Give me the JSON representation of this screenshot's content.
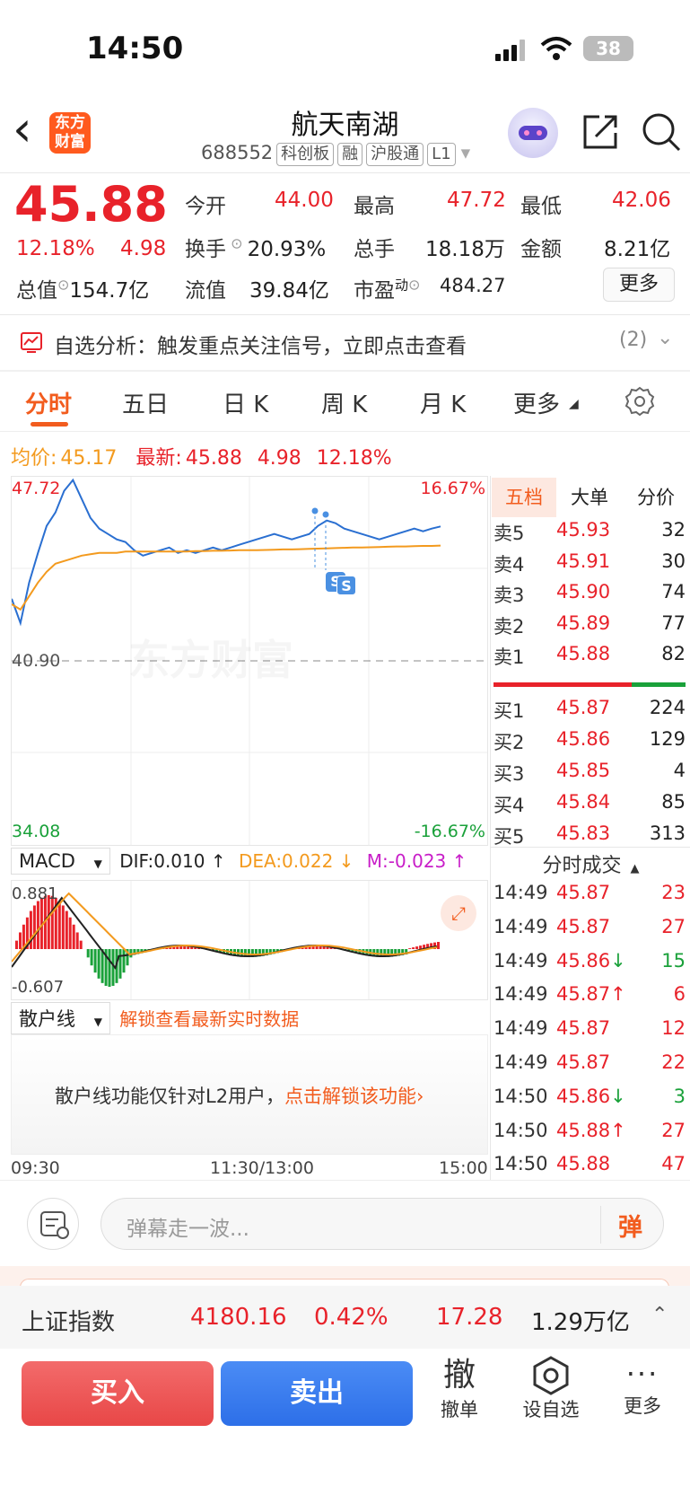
{
  "status": {
    "time": "14:50",
    "battery": "38"
  },
  "nav": {
    "back": "‹",
    "logo_line1": "东方",
    "logo_line2": "财富",
    "title": "航天南湖",
    "code": "688552",
    "tags": [
      "科创板",
      "融",
      "沪股通",
      "L1"
    ]
  },
  "quote": {
    "price": "45.88",
    "pct": "12.18%",
    "chg": "4.98",
    "open_label": "今开",
    "open": "44.00",
    "high_label": "最高",
    "high": "47.72",
    "low_label": "最低",
    "low": "42.06",
    "turnover_label": "换手",
    "turnover": "20.93%",
    "volume_label": "总手",
    "volume": "18.18万",
    "amount_label": "金额",
    "amount": "8.21亿",
    "mcap_label": "总值",
    "mcap": "154.7亿",
    "float_label": "流值",
    "float": "39.84亿",
    "pe_label": "市盈",
    "pe_sup": "动",
    "pe": "484.27",
    "more": "更多"
  },
  "alert": {
    "text": "自选分析：触发重点关注信号，立即点击查看",
    "count": "(2)"
  },
  "tabs": [
    "分时",
    "五日",
    "日 K",
    "周 K",
    "月 K",
    "更多"
  ],
  "chart_info": {
    "avg_label": "均价:",
    "avg": "45.17",
    "latest_label": "最新:",
    "latest": "45.88",
    "chg": "4.98",
    "pct": "12.18%"
  },
  "chart_data": {
    "type": "line",
    "title": "",
    "ylim": [
      34.08,
      47.72
    ],
    "y_top": "47.72",
    "y_mid": "40.90",
    "y_bottom": "34.08",
    "pct_top": "16.67%",
    "pct_bottom": "-16.67%",
    "x_labels": [
      "09:30",
      "11:30/13:00",
      "15:00"
    ],
    "watermark": "东方财富",
    "series": [
      {
        "name": "最新",
        "color": "#2a6fd1",
        "values": [
          43.2,
          42.3,
          43.8,
          44.9,
          45.9,
          46.4,
          47.2,
          47.6,
          46.9,
          46.2,
          45.8,
          45.6,
          45.4,
          45.3,
          45.0,
          44.8,
          44.9,
          45.0,
          45.1,
          44.9,
          45.0,
          44.9,
          45.0,
          45.1,
          45.0,
          45.1,
          45.2,
          45.3,
          45.4,
          45.5,
          45.6,
          45.5,
          45.4,
          45.5,
          45.6,
          45.9,
          46.1,
          46.0,
          45.8,
          45.7,
          45.6,
          45.5,
          45.4,
          45.5,
          45.6,
          45.7,
          45.8,
          45.7,
          45.8,
          45.88
        ]
      },
      {
        "name": "均价",
        "color": "#f39a1e",
        "values": [
          43.0,
          42.8,
          43.3,
          43.8,
          44.2,
          44.5,
          44.6,
          44.7,
          44.8,
          44.85,
          44.9,
          44.9,
          44.9,
          44.95,
          44.95,
          44.95,
          44.95,
          44.95,
          44.95,
          44.95,
          44.95,
          44.97,
          44.97,
          44.98,
          44.98,
          44.99,
          45.0,
          45.0,
          45.0,
          45.01,
          45.02,
          45.03,
          45.03,
          45.04,
          45.05,
          45.06,
          45.07,
          45.08,
          45.09,
          45.1,
          45.1,
          45.11,
          45.12,
          45.13,
          45.14,
          45.14,
          45.15,
          45.16,
          45.16,
          45.17
        ]
      }
    ]
  },
  "macd": {
    "name": "MACD",
    "dif": "DIF:0.010 ↑",
    "dea": "DEA:0.022 ↓",
    "m": "M:-0.023 ↑",
    "top": "0.881",
    "bottom": "-0.607"
  },
  "retail": {
    "name": "散户线",
    "unlock": "解锁查看最新实时数据",
    "notice": "散户线功能仅针对L2用户，",
    "notice_link": "点击解锁该功能›"
  },
  "orderbook": {
    "tabs": [
      "五档",
      "大单",
      "分价"
    ],
    "asks": [
      {
        "label": "卖5",
        "price": "45.93",
        "vol": "32"
      },
      {
        "label": "卖4",
        "price": "45.91",
        "vol": "30"
      },
      {
        "label": "卖3",
        "price": "45.90",
        "vol": "74"
      },
      {
        "label": "卖2",
        "price": "45.89",
        "vol": "77"
      },
      {
        "label": "卖1",
        "price": "45.88",
        "vol": "82"
      }
    ],
    "bids": [
      {
        "label": "买1",
        "price": "45.87",
        "vol": "224"
      },
      {
        "label": "买2",
        "price": "45.86",
        "vol": "129"
      },
      {
        "label": "买3",
        "price": "45.85",
        "vol": "4"
      },
      {
        "label": "买4",
        "price": "45.84",
        "vol": "85"
      },
      {
        "label": "买5",
        "price": "45.83",
        "vol": "313"
      }
    ]
  },
  "trades": {
    "title": "分时成交",
    "rows": [
      {
        "t": "14:49",
        "p": "45.87",
        "v": "23",
        "c": "red"
      },
      {
        "t": "14:49",
        "p": "45.87",
        "v": "27",
        "c": "red"
      },
      {
        "t": "14:49",
        "p": "45.86↓",
        "v": "15",
        "c": "green"
      },
      {
        "t": "14:49",
        "p": "45.87↑",
        "v": "6",
        "c": "red"
      },
      {
        "t": "14:49",
        "p": "45.87",
        "v": "12",
        "c": "red"
      },
      {
        "t": "14:49",
        "p": "45.87",
        "v": "22",
        "c": "red"
      },
      {
        "t": "14:50",
        "p": "45.86↓",
        "v": "3",
        "c": "green"
      },
      {
        "t": "14:50",
        "p": "45.88↑",
        "v": "27",
        "c": "red"
      },
      {
        "t": "14:50",
        "p": "45.88",
        "v": "47",
        "c": "red"
      }
    ]
  },
  "danmu": {
    "placeholder": "弹幕走一波...",
    "btn": "弹"
  },
  "index": {
    "name": "上证指数",
    "value": "4180.16",
    "pct": "0.42%",
    "chg": "17.28",
    "amount": "1.29万亿"
  },
  "actions": {
    "buy": "买入",
    "sell": "卖出",
    "cancel_icon": "撤",
    "cancel": "撤单",
    "watch": "设自选",
    "more": "更多"
  }
}
